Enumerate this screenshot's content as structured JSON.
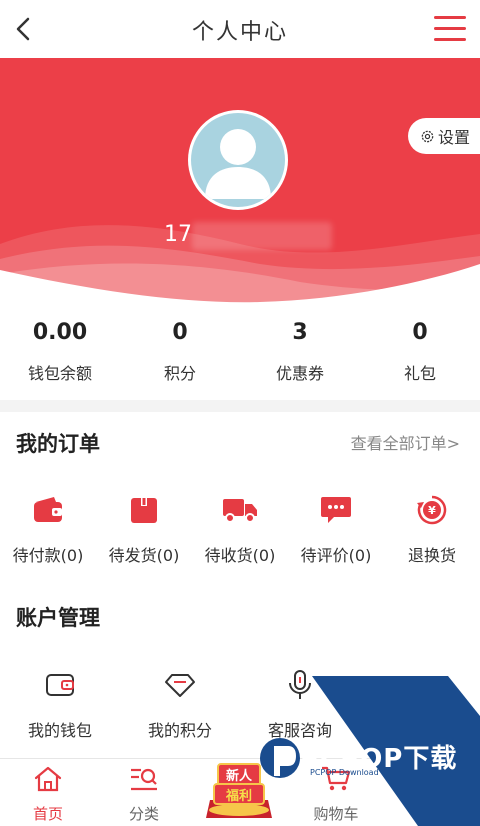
{
  "header": {
    "title": "个人中心"
  },
  "profile": {
    "settings_label": "设置",
    "username": "17"
  },
  "stats": [
    {
      "value": "0.00",
      "label": "钱包余额"
    },
    {
      "value": "0",
      "label": "积分"
    },
    {
      "value": "3",
      "label": "优惠券"
    },
    {
      "value": "0",
      "label": "礼包"
    }
  ],
  "orders": {
    "title": "我的订单",
    "view_all": "查看全部订单>",
    "items": [
      {
        "label": "待付款(0)",
        "icon": "wallet-icon"
      },
      {
        "label": "待发货(0)",
        "icon": "box-icon"
      },
      {
        "label": "待收货(0)",
        "icon": "truck-icon"
      },
      {
        "label": "待评价(0)",
        "icon": "comment-icon"
      },
      {
        "label": "退换货",
        "icon": "refund-icon"
      }
    ]
  },
  "account": {
    "title": "账户管理",
    "items": [
      {
        "label": "我的钱包",
        "icon": "wallet-outline-icon"
      },
      {
        "label": "我的积分",
        "icon": "diamond-icon"
      },
      {
        "label": "客服咨询",
        "icon": "microphone-icon"
      }
    ]
  },
  "nav": [
    {
      "label": "首页",
      "icon": "home-icon"
    },
    {
      "label": "分类",
      "icon": "category-search-icon"
    },
    {
      "label": "",
      "icon": "new-user-promo"
    },
    {
      "label": "购物车",
      "icon": "cart-icon"
    }
  ],
  "promo": {
    "line1": "新人",
    "line2": "福利"
  },
  "watermark": {
    "brand": "PCPOP下载",
    "sub": "PCPOP Download"
  },
  "colors": {
    "accent": "#e53b43",
    "hero": "#ec3f48"
  }
}
